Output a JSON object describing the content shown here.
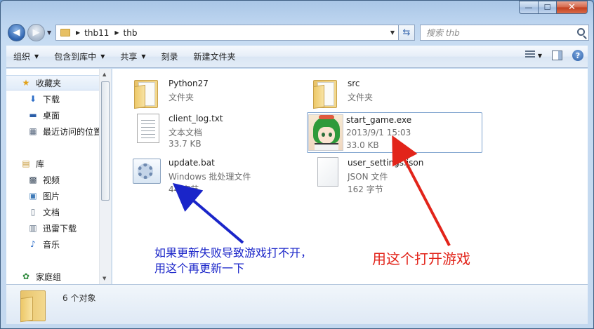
{
  "window": {
    "caption_min": "—",
    "caption_max": "☐",
    "caption_close": "✕"
  },
  "address": {
    "crumbs": [
      "thb11",
      "thb"
    ],
    "search_placeholder": "搜索 thb"
  },
  "toolbar": {
    "organize": "组织",
    "include_in_library": "包含到库中",
    "share": "共享",
    "burn": "刻录",
    "new_folder": "新建文件夹"
  },
  "sidebar": {
    "items": [
      {
        "label": "收藏夹",
        "icon": "star-icon"
      },
      {
        "label": "下载",
        "icon": "download-folder-icon"
      },
      {
        "label": "桌面",
        "icon": "desktop-icon"
      },
      {
        "label": "最近访问的位置",
        "icon": "recent-places-icon"
      },
      {
        "label": "库",
        "icon": "library-icon"
      },
      {
        "label": "视频",
        "icon": "video-icon"
      },
      {
        "label": "图片",
        "icon": "pictures-icon"
      },
      {
        "label": "文档",
        "icon": "documents-icon"
      },
      {
        "label": "迅雷下载",
        "icon": "thunder-download-icon"
      },
      {
        "label": "音乐",
        "icon": "music-icon"
      },
      {
        "label": "家庭组",
        "icon": "homegroup-icon"
      }
    ]
  },
  "files": [
    {
      "name": "Python27",
      "line1": "文件夹",
      "line2": "",
      "icon": "folder-icon"
    },
    {
      "name": "src",
      "line1": "文件夹",
      "line2": "",
      "icon": "folder-icon"
    },
    {
      "name": "client_log.txt",
      "line1": "文本文档",
      "line2": "33.7 KB",
      "icon": "text-file-icon"
    },
    {
      "name": "start_game.exe",
      "line1": "2013/9/1 15:03",
      "line2": "33.0 KB",
      "icon": "game-exe-icon"
    },
    {
      "name": "update.bat",
      "line1": "Windows 批处理文件",
      "line2": "44 字节",
      "icon": "batch-file-icon"
    },
    {
      "name": "user_settings.json",
      "line1": "JSON 文件",
      "line2": "162 字节",
      "icon": "json-file-icon"
    }
  ],
  "annotations": {
    "blue_line1": "如果更新失败导致游戏打不开，",
    "blue_line2": "用这个再更新一下",
    "red": "用这个打开游戏",
    "blue_color": "#1a25c9",
    "red_color": "#e2241a"
  },
  "status": {
    "item_count": "6 个对象"
  }
}
